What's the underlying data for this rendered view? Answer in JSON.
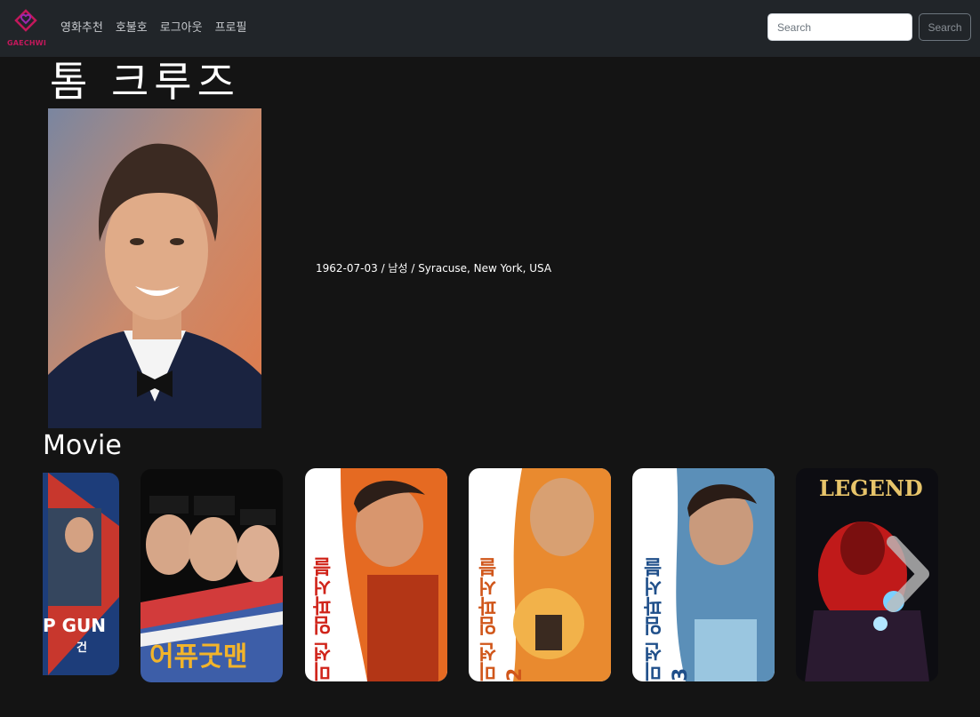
{
  "navbar": {
    "brand_text": "GAECHWI",
    "links": [
      "영화추천",
      "호불호",
      "로그아웃",
      "프로필"
    ],
    "search_placeholder": "Search",
    "search_button_label": "Search"
  },
  "person": {
    "name": "톰 크루즈",
    "birthday": "1962-07-03",
    "separator1": " / ",
    "gender": "남성",
    "separator2": " / ",
    "birthplace": "Syracuse, New York, USA"
  },
  "movies_section": {
    "title": "Movie",
    "posters": [
      {
        "visible_text": "P GUN",
        "subtitle": "건"
      },
      {
        "visible_text": "어퓨굿맨"
      },
      {
        "visible_text": "미션 임파서블"
      },
      {
        "visible_text": "미션 임파서블 2"
      },
      {
        "visible_text": "미션 임파서블 3"
      },
      {
        "visible_text": "LEGEND"
      }
    ]
  },
  "colors": {
    "background": "#141414",
    "navbar": "#212529",
    "brand": "#c2185b"
  }
}
